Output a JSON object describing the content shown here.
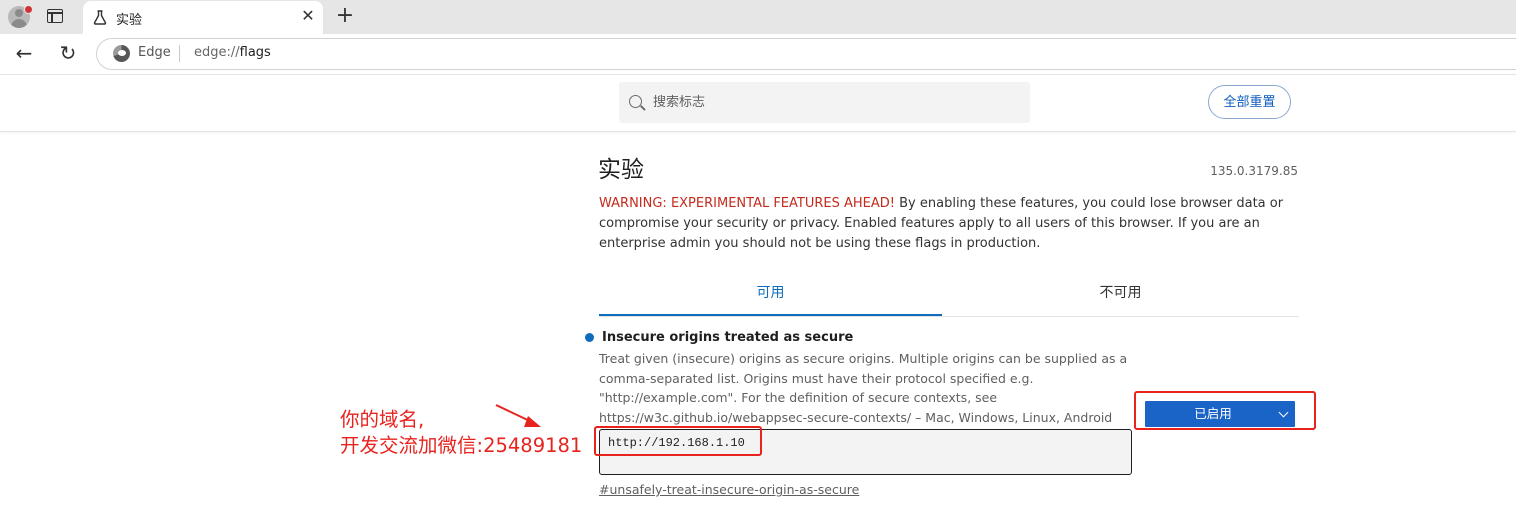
{
  "browser": {
    "tab_title": "实验",
    "tab_close_glyph": "✕",
    "new_tab_glyph": "+",
    "back_glyph": "←",
    "reload_glyph": "↻",
    "omnibox_label": "Edge",
    "url_scheme": "edge://",
    "url_host": "flags"
  },
  "header": {
    "search_placeholder": "搜索标志",
    "reset_label": "全部重置"
  },
  "main": {
    "title": "实验",
    "version": "135.0.3179.85",
    "warning_head": "WARNING: EXPERIMENTAL FEATURES AHEAD!",
    "warning_body": " By enabling these features, you could lose browser data or compromise your security or privacy. Enabled features apply to all users of this browser. If you are an enterprise admin you should not be using these flags in production.",
    "tabs": [
      {
        "label": "可用",
        "active": true
      },
      {
        "label": "不可用",
        "active": false
      }
    ]
  },
  "flag": {
    "title": "Insecure origins treated as secure",
    "description": "Treat given (insecure) origins as secure origins. Multiple origins can be supplied as a comma-separated list. Origins must have their protocol specified e.g. \"http://example.com\". For the definition of secure contexts, see https://w3c.github.io/webappsec-secure-contexts/ – Mac, Windows, Linux, Android",
    "value": "http://192.168.1.10",
    "link": "#unsafely-treat-insecure-origin-as-secure",
    "state": "已启用"
  },
  "annotation": {
    "line1": "你的域名,",
    "line2": "开发交流加微信:25489181"
  },
  "colors": {
    "accent": "#0f6cbd",
    "warning": "#c42b1c",
    "annotation": "#e8231e",
    "select_bg": "#1a64c8"
  }
}
